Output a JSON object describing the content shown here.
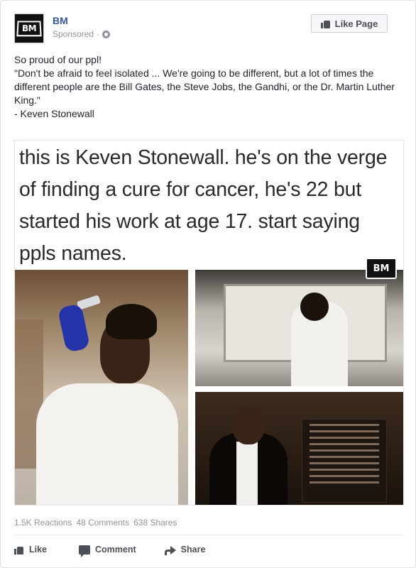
{
  "post": {
    "page_name": "BM",
    "avatar_logo": "BM",
    "sponsored_label": "Sponsored",
    "separator": "·",
    "like_page_label": "Like Page",
    "text_lines": [
      "So proud of our ppl!",
      "\"Don't be afraid to feel isolated ... We're going to be different, but a lot of times the different people are the Bill Gates, the Steve Jobs, the Gandhi, or the Dr. Martin Luther King.\"",
      "- Keven Stonewall"
    ]
  },
  "image": {
    "caption": "this is Keven Stonewall. he's on the verge of finding a cure for cancer, he's 22 but started his work at age 17. start saying ppls names.",
    "watermark": "BM"
  },
  "stats": {
    "reactions": "1.5K Reactions",
    "comments": "48 Comments",
    "shares": "638 Shares"
  },
  "actions": {
    "like": "Like",
    "comment": "Comment",
    "share": "Share"
  },
  "colors": {
    "link": "#365899",
    "muted": "#90949c",
    "text": "#1d2129"
  }
}
